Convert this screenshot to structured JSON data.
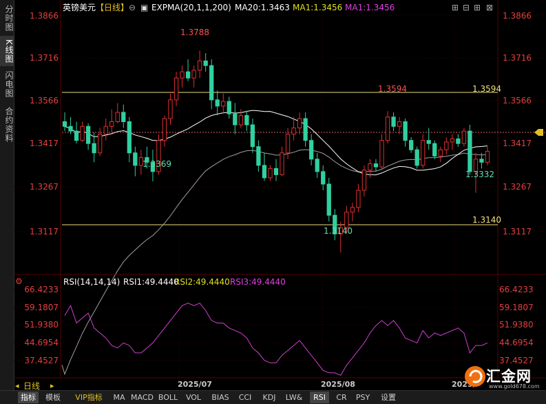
{
  "left_tabs": [
    {
      "label": "分时图",
      "active": false
    },
    {
      "label": "K线图",
      "active": true
    },
    {
      "label": "闪电图",
      "active": false
    },
    {
      "label": "合约资料",
      "active": false
    }
  ],
  "header": {
    "symbol": "英镑美元",
    "period": "【日线】",
    "indicators": [
      {
        "text": "EXPMA(20,1,1,200)",
        "color": "#ffffff"
      },
      {
        "text": "MA20:1.3463",
        "color": "#ffffff"
      },
      {
        "text": "MA1:1.3456",
        "color": "#e0e020"
      },
      {
        "text": "MA1:1.3456",
        "color": "#e040e0"
      }
    ]
  },
  "price_axis": {
    "labels": [
      "1.3866",
      "1.3716",
      "1.3566",
      "1.3417",
      "1.3267",
      "1.3117"
    ],
    "color": "#e04040"
  },
  "annotations": {
    "high": "1.3788",
    "low": "1.3140",
    "swing_low_1": "1.3369",
    "swing_low_2": "1.3332",
    "resistance": "1.3594",
    "resistance_tag": "1.3594",
    "support_tag": "1.3140"
  },
  "rsi": {
    "title": "RSI(14,14,14)",
    "rsi1": "RSI1:49.4440",
    "rsi2": "RSI2:49.4440",
    "rsi3": "RSI3:49.4440",
    "axis_labels": [
      "66.4233",
      "59.1807",
      "51.9380",
      "44.6954",
      "37.4527"
    ]
  },
  "time_axis": {
    "labels": [
      "2025/07",
      "2025/08",
      "2025/"
    ]
  },
  "period_label": "日线",
  "bottom_tabs": [
    {
      "label": "指标",
      "active": true
    },
    {
      "label": "模板"
    },
    {
      "label": "VIP指标",
      "vip": true
    },
    {
      "label": "MA"
    },
    {
      "label": "MACD"
    },
    {
      "label": "BOLL"
    },
    {
      "label": "VOL"
    },
    {
      "label": "BIAS"
    },
    {
      "label": "CCI"
    },
    {
      "label": "KDJ"
    },
    {
      "label": "LW&"
    },
    {
      "label": "RSI",
      "active": true
    },
    {
      "label": "CR"
    },
    {
      "label": "PSY"
    },
    {
      "label": "设置"
    }
  ],
  "logo": {
    "text": "汇金网",
    "url": "www.gold678.com"
  },
  "colors": {
    "up": "#e03030",
    "down": "#30d0a0",
    "ma_line": "#ffffff",
    "expma": "#c0c0c0",
    "level_line": "#f0e080",
    "rsi_line": "#d040d0",
    "axis_text": "#e04040",
    "grid": "#3a0000"
  },
  "chart_data": {
    "type": "candlestick",
    "price_ylim": [
      1.3077,
      1.3906
    ],
    "rsi_ylim": [
      34.0,
      70.0
    ],
    "candles": [
      [
        1.356,
        1.359,
        1.353,
        1.3545
      ],
      [
        1.3545,
        1.3575,
        1.352,
        1.353
      ],
      [
        1.353,
        1.356,
        1.349,
        1.35
      ],
      [
        1.35,
        1.356,
        1.3495,
        1.3545
      ],
      [
        1.3545,
        1.3555,
        1.347,
        1.349
      ],
      [
        1.349,
        1.3525,
        1.343,
        1.346
      ],
      [
        1.346,
        1.354,
        1.345,
        1.352
      ],
      [
        1.352,
        1.357,
        1.35,
        1.3545
      ],
      [
        1.3545,
        1.36,
        1.3525,
        1.356
      ],
      [
        1.356,
        1.362,
        1.3555,
        1.359
      ],
      [
        1.359,
        1.3615,
        1.354,
        1.356
      ],
      [
        1.356,
        1.3575,
        1.343,
        1.346
      ],
      [
        1.346,
        1.348,
        1.3385,
        1.342
      ],
      [
        1.342,
        1.347,
        1.339,
        1.3445
      ],
      [
        1.3445,
        1.348,
        1.341,
        1.343
      ],
      [
        1.343,
        1.347,
        1.3369,
        1.34
      ],
      [
        1.34,
        1.352,
        1.339,
        1.35
      ],
      [
        1.35,
        1.358,
        1.348,
        1.357
      ],
      [
        1.357,
        1.365,
        1.355,
        1.363
      ],
      [
        1.363,
        1.372,
        1.361,
        1.37
      ],
      [
        1.37,
        1.374,
        1.367,
        1.372
      ],
      [
        1.372,
        1.376,
        1.369,
        1.37
      ],
      [
        1.37,
        1.374,
        1.367,
        1.3725
      ],
      [
        1.3725,
        1.3788,
        1.37,
        1.3755
      ],
      [
        1.3755,
        1.378,
        1.372,
        1.374
      ],
      [
        1.374,
        1.376,
        1.36,
        1.363
      ],
      [
        1.363,
        1.366,
        1.358,
        1.361
      ],
      [
        1.361,
        1.365,
        1.3585,
        1.3625
      ],
      [
        1.3625,
        1.364,
        1.357,
        1.3585
      ],
      [
        1.3585,
        1.362,
        1.352,
        1.355
      ],
      [
        1.355,
        1.36,
        1.354,
        1.358
      ],
      [
        1.358,
        1.3595,
        1.353,
        1.355
      ],
      [
        1.355,
        1.357,
        1.346,
        1.348
      ],
      [
        1.348,
        1.35,
        1.34,
        1.342
      ],
      [
        1.342,
        1.346,
        1.337,
        1.338
      ],
      [
        1.338,
        1.342,
        1.337,
        1.341
      ],
      [
        1.341,
        1.344,
        1.337,
        1.339
      ],
      [
        1.339,
        1.348,
        1.3385,
        1.346
      ],
      [
        1.346,
        1.354,
        1.344,
        1.352
      ],
      [
        1.352,
        1.3575,
        1.35,
        1.354
      ],
      [
        1.354,
        1.359,
        1.352,
        1.357
      ],
      [
        1.357,
        1.359,
        1.348,
        1.35
      ],
      [
        1.35,
        1.352,
        1.342,
        1.344
      ],
      [
        1.344,
        1.346,
        1.338,
        1.34
      ],
      [
        1.34,
        1.342,
        1.334,
        1.336
      ],
      [
        1.336,
        1.338,
        1.324,
        1.326
      ],
      [
        1.326,
        1.328,
        1.318,
        1.32
      ],
      [
        1.32,
        1.324,
        1.314,
        1.322
      ],
      [
        1.322,
        1.329,
        1.32,
        1.327
      ],
      [
        1.327,
        1.33,
        1.324,
        1.3285
      ],
      [
        1.3285,
        1.336,
        1.327,
        1.334
      ],
      [
        1.334,
        1.342,
        1.332,
        1.3405
      ],
      [
        1.3405,
        1.344,
        1.338,
        1.3425
      ],
      [
        1.3425,
        1.344,
        1.34,
        1.3415
      ],
      [
        1.3415,
        1.352,
        1.3405,
        1.35
      ],
      [
        1.35,
        1.3594,
        1.349,
        1.3575
      ],
      [
        1.3575,
        1.359,
        1.353,
        1.3545
      ],
      [
        1.3545,
        1.3575,
        1.352,
        1.356
      ],
      [
        1.356,
        1.357,
        1.348,
        1.35
      ],
      [
        1.35,
        1.351,
        1.346,
        1.347
      ],
      [
        1.347,
        1.348,
        1.341,
        1.342
      ],
      [
        1.342,
        1.352,
        1.341,
        1.35
      ],
      [
        1.35,
        1.354,
        1.347,
        1.349
      ],
      [
        1.349,
        1.35,
        1.344,
        1.345
      ],
      [
        1.345,
        1.348,
        1.343,
        1.347
      ],
      [
        1.347,
        1.351,
        1.3455,
        1.3495
      ],
      [
        1.3495,
        1.352,
        1.347,
        1.3505
      ],
      [
        1.3505,
        1.352,
        1.348,
        1.349
      ],
      [
        1.349,
        1.354,
        1.348,
        1.353
      ],
      [
        1.353,
        1.355,
        1.339,
        1.34
      ],
      [
        1.34,
        1.346,
        1.3332,
        1.344
      ],
      [
        1.344,
        1.346,
        1.341,
        1.343
      ],
      [
        1.343,
        1.348,
        1.342,
        1.3465
      ]
    ],
    "rsi_values": [
      59,
      63,
      56,
      58,
      60,
      54,
      52,
      50,
      47,
      46,
      48,
      47,
      44,
      44,
      46,
      48,
      51,
      54,
      57,
      60,
      63,
      64,
      63,
      64,
      61,
      57,
      56,
      56,
      54,
      53,
      52,
      50,
      46,
      44,
      41,
      40,
      40,
      43,
      45,
      47,
      49,
      46,
      43,
      40,
      37,
      36,
      36,
      35,
      39,
      42,
      45,
      48,
      52,
      55,
      57,
      55,
      57,
      54,
      50,
      49,
      48,
      53,
      50,
      52,
      51,
      52,
      53,
      54,
      52,
      44,
      47,
      47,
      48
    ]
  }
}
